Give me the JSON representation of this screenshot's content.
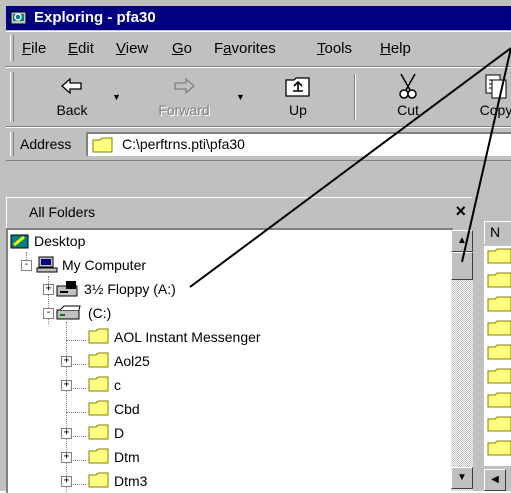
{
  "window": {
    "title": "Exploring - pfa30"
  },
  "menu": {
    "items": [
      {
        "prefix": "",
        "ul": "F",
        "rest": "ile"
      },
      {
        "prefix": "",
        "ul": "E",
        "rest": "dit"
      },
      {
        "prefix": "",
        "ul": "V",
        "rest": "iew"
      },
      {
        "prefix": "",
        "ul": "G",
        "rest": "o"
      },
      {
        "prefix": "F",
        "ul": "a",
        "rest": "vorites"
      },
      {
        "prefix": "",
        "ul": "T",
        "rest": "ools"
      },
      {
        "prefix": "",
        "ul": "H",
        "rest": "elp"
      }
    ]
  },
  "toolbar": {
    "back_label": "Back",
    "forward_label": "Forward",
    "up_label": "Up",
    "cut_label": "Cut",
    "copy_label": "Copy"
  },
  "address": {
    "label": "Address",
    "value": "C:\\perftrns.pti\\pfa30"
  },
  "folders": {
    "title": "All Folders",
    "close_glyph": "×",
    "tree": [
      {
        "label": "Desktop"
      },
      {
        "label": "My Computer"
      },
      {
        "label": "3½ Floppy (A:)"
      },
      {
        "label": "(C:)"
      },
      {
        "label": "AOL Instant Messenger"
      },
      {
        "label": "Aol25"
      },
      {
        "label": "c"
      },
      {
        "label": "Cbd"
      },
      {
        "label": "D"
      },
      {
        "label": "Dtm"
      },
      {
        "label": "Dtm3"
      }
    ]
  },
  "right_pane": {
    "column_header": "N"
  },
  "icons": [
    "explorer-icon",
    "back-arrow-icon",
    "forward-arrow-icon",
    "up-folder-icon",
    "scissors-icon",
    "copy-icon",
    "folder-icon",
    "desktop-icon",
    "computer-icon",
    "floppy-drive-icon",
    "hard-drive-icon"
  ],
  "colors": {
    "titlebar": "#000080",
    "face": "#c0c0c0",
    "folder": "#ffff80"
  }
}
